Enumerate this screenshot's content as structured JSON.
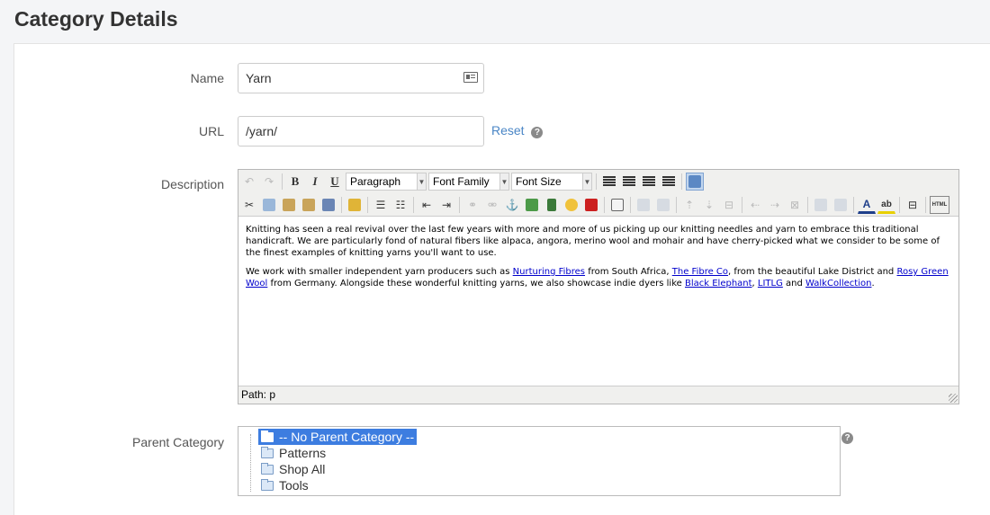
{
  "page": {
    "title": "Category Details"
  },
  "form": {
    "name_label": "Name",
    "name_value": "Yarn",
    "url_label": "URL",
    "url_value": "/yarn/",
    "reset_label": "Reset",
    "description_label": "Description",
    "parent_label": "Parent Category"
  },
  "editor": {
    "paragraph_select": "Paragraph",
    "font_family_select": "Font Family",
    "font_size_select": "Font Size",
    "bold": "B",
    "italic": "I",
    "underline": "U",
    "path": "Path: p",
    "p1": "Knitting has seen a real revival over the last few years with more and more of us picking up our knitting needles and yarn to embrace this traditional handicraft. We are particularly fond of natural fibers like alpaca, angora, merino wool and mohair and have cherry-picked what we consider to be some of the finest examples of knitting yarns you'll want to use.",
    "p2_a": "We work with smaller independent yarn producers such as ",
    "link1": "Nurturing Fibres",
    "p2_b": " from South Africa, ",
    "link2": "The Fibre Co",
    "p2_c": ", from the beautiful Lake District and ",
    "link3": "Rosy Green Wool",
    "p2_d": " from Germany. Alongside these wonderful knitting yarns, we also showcase indie dyers like ",
    "link4": "Black Elephant",
    "p2_e": ", ",
    "link5": "LITLG",
    "p2_f": " and ",
    "link6": "WalkCollection",
    "p2_g": "."
  },
  "tree": {
    "items": [
      {
        "label": "-- No Parent Category --",
        "selected": true
      },
      {
        "label": "Patterns"
      },
      {
        "label": "Shop All"
      },
      {
        "label": "Tools"
      }
    ]
  },
  "colors": {
    "link": "#4a86c6",
    "selection": "#3d7de0"
  }
}
